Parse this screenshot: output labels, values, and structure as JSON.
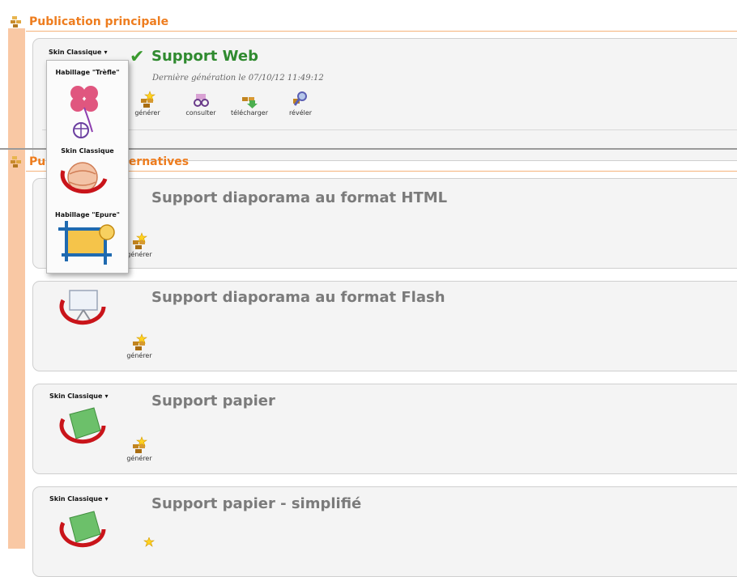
{
  "sections": {
    "main": {
      "title": "Publication principale"
    },
    "alt": {
      "title": "Publications alternatives"
    }
  },
  "web": {
    "skin_label": "Skin Classique",
    "title": "Support Web",
    "generated": "Dernière génération le 07/10/12 11:49:12",
    "actions": [
      {
        "label": "générer",
        "icon": "bricks-star-icon"
      },
      {
        "label": "consulter",
        "icon": "glasses-icon"
      },
      {
        "label": "télécharger",
        "icon": "download-icon"
      },
      {
        "label": "révéler",
        "icon": "magnify-icon"
      }
    ]
  },
  "skin_menu": {
    "items": [
      {
        "label": "Habillage \"Trèfle\"",
        "icon": "clover-icon"
      },
      {
        "label": "Skin Classique",
        "icon": "classic-globe-icon"
      },
      {
        "label": "Habillage \"Epure\"",
        "icon": "epure-frame-icon"
      }
    ]
  },
  "alt_cards": [
    {
      "title": "Support diaporama au format HTML",
      "action": "générer"
    },
    {
      "title": "Support diaporama au format Flash",
      "action": "générer"
    },
    {
      "title": "Support papier",
      "skin_label": "Skin Classique",
      "action": "générer"
    },
    {
      "title": "Support papier - simplifié",
      "skin_label": "Skin Classique"
    }
  ],
  "colors": {
    "accent": "#ee7d1f",
    "sidebar": "#f9c8a4",
    "web_title": "#2f8a2f",
    "card_bg": "#f4f4f4"
  }
}
